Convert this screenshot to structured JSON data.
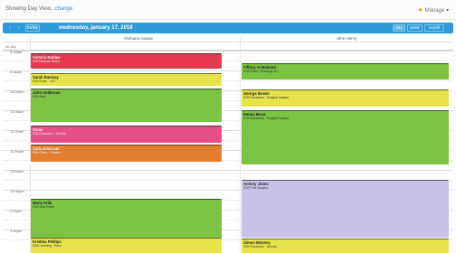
{
  "header": {
    "view_prefix": "Showing Day View...",
    "change_link": "change",
    "manage_label": "Manage ▾"
  },
  "nav": {
    "prev": "‹",
    "next": "›",
    "today": "today",
    "date": "wednesday, january 17, 2018",
    "views": {
      "day": "day",
      "week": "week",
      "month": "month"
    }
  },
  "columns": {
    "left": "Farhana Asawa",
    "right": "John Henry"
  },
  "allday_label": "all-day",
  "times": [
    "9:00am",
    "9:30am",
    "10:00am",
    "10:30am",
    "11:00am",
    "11:30am",
    "12:00pm",
    "12:30pm",
    "1:00pm",
    "1:30pm",
    "2:00pm"
  ],
  "events": {
    "left": [
      {
        "title": "Victoria Robles",
        "sub": "9/30 Reason: Notes",
        "color": "#e73a50"
      },
      {
        "title": "Sarah Ramsey",
        "sub": "9/30 Exam · 4/17",
        "color": "#e8e24a"
      },
      {
        "title": "John Anderson",
        "sub": "9/30 New",
        "color": "#7cc243"
      },
      {
        "title": "Sonia",
        "sub": "9/30 Extraction · Normal",
        "color": "#e84f87"
      },
      {
        "title": "Carla Emerson",
        "sub": "9/30 Clean · Routine",
        "color": "#e27e2e"
      },
      {
        "title": "Maria Ariki",
        "sub": "9/30 New Exam",
        "color": "#7cc243"
      },
      {
        "title": "Kristina Phillips",
        "sub": "9/30 Cleaning · Perio",
        "color": "#e8e24a"
      }
    ],
    "right": [
      {
        "title": "Tiffany Al-Bahrani",
        "sub": "9/30 Exam Cleanings-4/C",
        "color": "#7cc243"
      },
      {
        "title": "George Brown",
        "sub": "9/30 Extraction · Surgical Implant",
        "color": "#e8e24a"
      },
      {
        "title": "Emma Moss",
        "sub": "9/30 Extraction · Surgical Implant",
        "color": "#7cc243"
      },
      {
        "title": "Antony Jones",
        "sub": "9/30 Post Surgery",
        "color": "#c7c3e6"
      },
      {
        "title": "Simon Mooney",
        "sub": "9/30 Extraction · Normal",
        "color": "#e8e24a"
      }
    ]
  }
}
